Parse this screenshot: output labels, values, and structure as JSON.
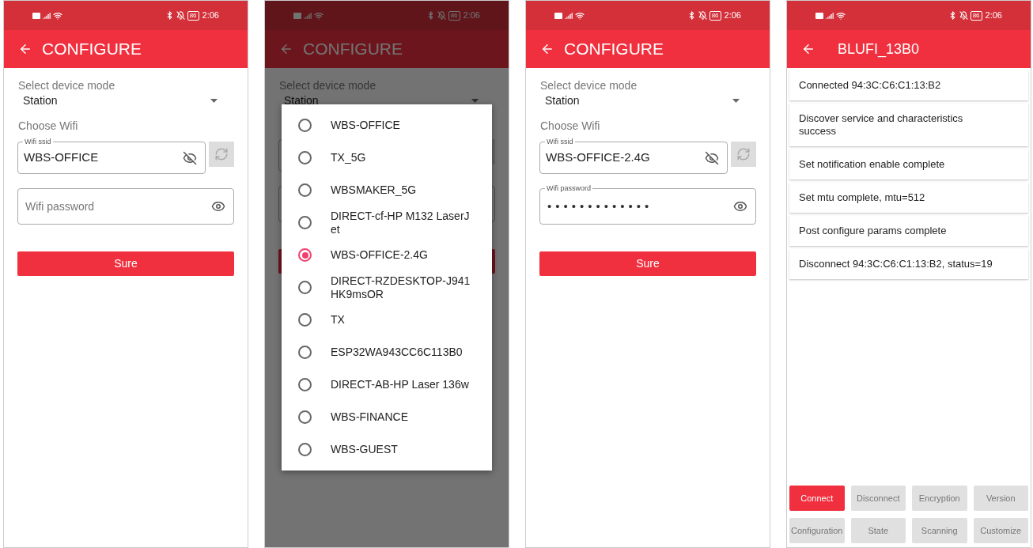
{
  "phones": [
    {
      "kind": "configure",
      "status_bar": {
        "battery": "86",
        "time": "2:06"
      },
      "toolbar": {
        "title": "CONFIGURE"
      },
      "mode_label": "Select device mode",
      "mode_value": "Station",
      "section_label": "Choose Wifi",
      "ssid": {
        "label": "Wifi ssid",
        "value": "WBS-OFFICE"
      },
      "password": {
        "placeholder": "Wifi password"
      },
      "sure_button": "Sure"
    },
    {
      "kind": "picker",
      "status_bar": {
        "battery": "86",
        "time": "2:06"
      },
      "toolbar": {
        "title": "CONFIGURE"
      },
      "mode_label": "Select device mode",
      "mode_value": "Station",
      "dialog": {
        "options": [
          {
            "label": "WBS-OFFICE",
            "selected": false
          },
          {
            "label": "TX_5G",
            "selected": false
          },
          {
            "label": "WBSMAKER_5G",
            "selected": false
          },
          {
            "label": "DIRECT-cf-HP M132 LaserJet",
            "selected": false
          },
          {
            "label": "WBS-OFFICE-2.4G",
            "selected": true
          },
          {
            "label": "DIRECT-RZDESKTOP-J941HK9msOR",
            "selected": false
          },
          {
            "label": "TX",
            "selected": false
          },
          {
            "label": "ESP32WA943CC6C113B0",
            "selected": false
          },
          {
            "label": "DIRECT-AB-HP Laser 136w",
            "selected": false
          },
          {
            "label": "WBS-FINANCE",
            "selected": false
          },
          {
            "label": "WBS-GUEST",
            "selected": false
          }
        ]
      }
    },
    {
      "kind": "configure",
      "status_bar": {
        "battery": "86",
        "time": "2:06"
      },
      "toolbar": {
        "title": "CONFIGURE"
      },
      "mode_label": "Select device mode",
      "mode_value": "Station",
      "section_label": "Choose Wifi",
      "ssid": {
        "label": "Wifi ssid",
        "value": "WBS-OFFICE-2.4G"
      },
      "password": {
        "label": "Wifi password",
        "value": "•••••••••••••"
      },
      "sure_button": "Sure"
    },
    {
      "kind": "log",
      "status_bar": {
        "battery": "86",
        "time": "2:06"
      },
      "toolbar": {
        "title": "BLUFI_13B0"
      },
      "messages": [
        "Connected 94:3C:C6:C1:13:B2",
        "Discover service and characteristics success",
        "Set notification enable  complete",
        "Set mtu complete, mtu=512",
        "Post configure params complete",
        "Disconnect 94:3C:C6:C1:13:B2, status=19"
      ],
      "buttons": [
        {
          "label": "Connect",
          "selected": true
        },
        {
          "label": "Disconnect",
          "selected": false
        },
        {
          "label": "Encryption",
          "selected": false
        },
        {
          "label": "Version",
          "selected": false
        },
        {
          "label": "Configuration",
          "selected": false
        },
        {
          "label": "State",
          "selected": false
        },
        {
          "label": "Scanning",
          "selected": false
        },
        {
          "label": "Customize",
          "selected": false
        }
      ]
    }
  ]
}
